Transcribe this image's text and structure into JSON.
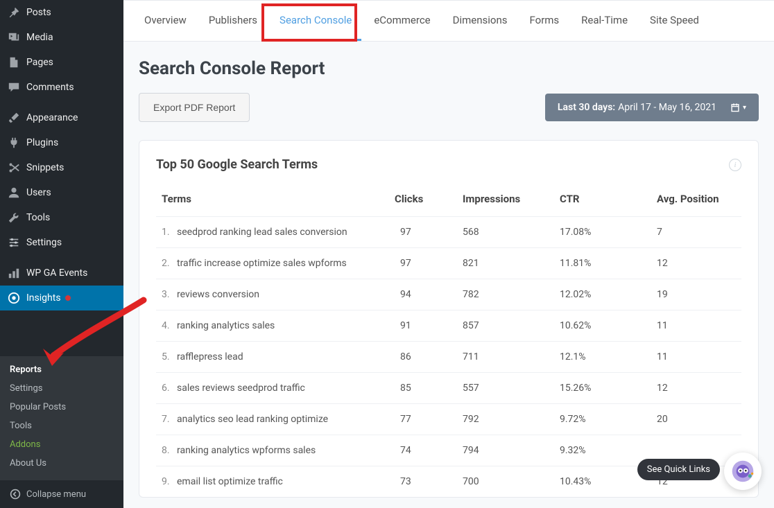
{
  "sidebar": {
    "items": [
      {
        "label": "Posts",
        "icon": "pin"
      },
      {
        "label": "Media",
        "icon": "media"
      },
      {
        "label": "Pages",
        "icon": "page"
      },
      {
        "label": "Comments",
        "icon": "comment"
      },
      {
        "label": "Appearance",
        "icon": "brush"
      },
      {
        "label": "Plugins",
        "icon": "plug"
      },
      {
        "label": "Snippets",
        "icon": "scissors"
      },
      {
        "label": "Users",
        "icon": "user"
      },
      {
        "label": "Tools",
        "icon": "wrench"
      },
      {
        "label": "Settings",
        "icon": "sliders"
      },
      {
        "label": "WP GA Events",
        "icon": "ga"
      },
      {
        "label": "Insights",
        "icon": "insights"
      }
    ],
    "submenu": [
      {
        "label": "Reports"
      },
      {
        "label": "Settings"
      },
      {
        "label": "Popular Posts"
      },
      {
        "label": "Tools"
      },
      {
        "label": "Addons"
      },
      {
        "label": "About Us"
      }
    ],
    "collapse_label": "Collapse menu"
  },
  "tabs": [
    {
      "label": "Overview"
    },
    {
      "label": "Publishers"
    },
    {
      "label": "Search Console"
    },
    {
      "label": "eCommerce"
    },
    {
      "label": "Dimensions"
    },
    {
      "label": "Forms"
    },
    {
      "label": "Real-Time"
    },
    {
      "label": "Site Speed"
    }
  ],
  "page": {
    "title": "Search Console Report",
    "export_label": "Export PDF Report",
    "daterange_label": "Last 30 days:",
    "daterange_value": "April 17 - May 16, 2021"
  },
  "card": {
    "title": "Top 50 Google Search Terms",
    "headers": {
      "terms": "Terms",
      "clicks": "Clicks",
      "impressions": "Impressions",
      "ctr": "CTR",
      "position": "Avg. Position"
    },
    "rows": [
      {
        "n": "1.",
        "term": "seedprod ranking lead sales conversion",
        "clicks": "97",
        "impr": "568",
        "ctr": "17.08%",
        "pos": "7"
      },
      {
        "n": "2.",
        "term": "traffic increase optimize sales wpforms",
        "clicks": "97",
        "impr": "821",
        "ctr": "11.81%",
        "pos": "12"
      },
      {
        "n": "3.",
        "term": "reviews conversion",
        "clicks": "94",
        "impr": "782",
        "ctr": "12.02%",
        "pos": "19"
      },
      {
        "n": "4.",
        "term": "ranking analytics sales",
        "clicks": "91",
        "impr": "857",
        "ctr": "10.62%",
        "pos": "11"
      },
      {
        "n": "5.",
        "term": "rafflepress lead",
        "clicks": "86",
        "impr": "711",
        "ctr": "12.1%",
        "pos": "11"
      },
      {
        "n": "6.",
        "term": "sales reviews seedprod traffic",
        "clicks": "85",
        "impr": "557",
        "ctr": "15.26%",
        "pos": "12"
      },
      {
        "n": "7.",
        "term": "analytics seo lead ranking optimize",
        "clicks": "77",
        "impr": "792",
        "ctr": "9.72%",
        "pos": "20"
      },
      {
        "n": "8.",
        "term": "ranking analytics wpforms sales",
        "clicks": "74",
        "impr": "794",
        "ctr": "9.32%",
        "pos": ""
      },
      {
        "n": "9.",
        "term": "email list optimize traffic",
        "clicks": "73",
        "impr": "700",
        "ctr": "10.43%",
        "pos": "12"
      }
    ]
  },
  "quicklinks_label": "See Quick Links",
  "colors": {
    "accent": "#509fe2",
    "highlight_box": "#e02424",
    "sidebar_active": "#0073aa",
    "addons": "#7fb848"
  }
}
